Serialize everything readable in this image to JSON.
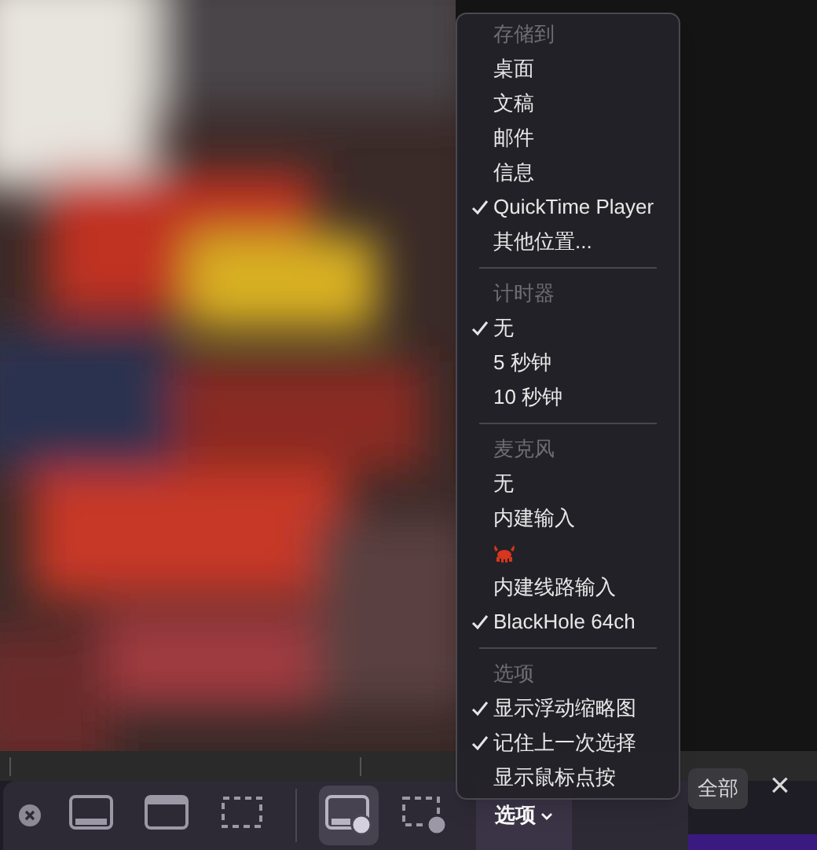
{
  "menu": {
    "sections": [
      {
        "title": "存储到",
        "items": [
          {
            "kind": "text",
            "label": "桌面",
            "checked": false
          },
          {
            "kind": "text",
            "label": "文稿",
            "checked": false
          },
          {
            "kind": "text",
            "label": "邮件",
            "checked": false
          },
          {
            "kind": "text",
            "label": "信息",
            "checked": false
          },
          {
            "kind": "text",
            "label": "QuickTime Player",
            "checked": true
          },
          {
            "kind": "text",
            "label": "其他位置...",
            "checked": false
          }
        ]
      },
      {
        "title": "计时器",
        "items": [
          {
            "kind": "text",
            "label": "无",
            "checked": true
          },
          {
            "kind": "text",
            "label": "5 秒钟",
            "checked": false
          },
          {
            "kind": "text",
            "label": "10 秒钟",
            "checked": false
          }
        ]
      },
      {
        "title": "麦克风",
        "items": [
          {
            "kind": "text",
            "label": "无",
            "checked": false
          },
          {
            "kind": "text",
            "label": "内建输入",
            "checked": false
          },
          {
            "kind": "crab",
            "checked": false
          },
          {
            "kind": "text",
            "label": "内建线路输入",
            "checked": false
          },
          {
            "kind": "text",
            "label": "BlackHole 64ch",
            "checked": true
          }
        ]
      },
      {
        "title": "选项",
        "items": [
          {
            "kind": "text",
            "label": "显示浮动缩略图",
            "checked": true
          },
          {
            "kind": "text",
            "label": "记住上一次选择",
            "checked": true
          },
          {
            "kind": "text",
            "label": "显示鼠标点按",
            "checked": false
          }
        ]
      }
    ]
  },
  "toolbar": {
    "buttons": [
      {
        "kind": "screen",
        "selected": false
      },
      {
        "kind": "window",
        "selected": false
      },
      {
        "kind": "selection",
        "selected": false
      },
      {
        "kind": "record-screen",
        "selected": true
      },
      {
        "kind": "record-selection",
        "selected": false
      }
    ],
    "options_button": {
      "label": "选项"
    }
  },
  "record_all_button": {
    "label": "全部"
  },
  "close_button": {
    "label": "×"
  }
}
